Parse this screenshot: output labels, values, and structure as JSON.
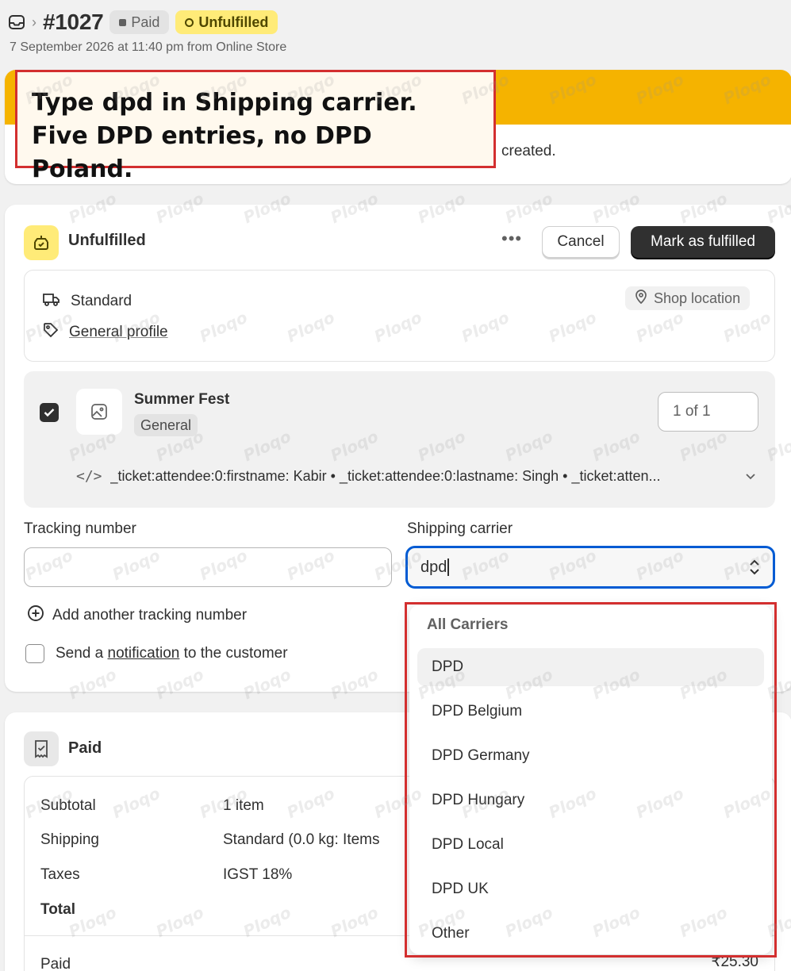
{
  "order": {
    "number": "#1027",
    "payment_badge": "Paid",
    "fulfillment_badge": "Unfulfilled",
    "subtitle": "7 September 2026 at 11:40 pm from Online Store"
  },
  "alert": {
    "visible_tail": "created."
  },
  "annotation": {
    "line1": "Type dpd in Shipping carrier.",
    "line2": "Five DPD entries, no DPD Poland."
  },
  "fulfillment": {
    "title": "Unfulfilled",
    "more_label": "•••",
    "cancel_label": "Cancel",
    "mark_label": "Mark as fulfilled",
    "method": "Standard",
    "profile": "General profile",
    "location": "Shop location",
    "item": {
      "name": "Summer Fest",
      "tag": "General",
      "quantity": "1 of 1",
      "properties": "_ticket:attendee:0:firstname: Kabir • _ticket:attendee:0:lastname: Singh • _ticket:atten..."
    },
    "tracking_label": "Tracking number",
    "tracking_value": "",
    "carrier_label": "Shipping carrier",
    "carrier_value": "dpd",
    "add_tracking": "Add another tracking number",
    "notify_prefix": "Send a ",
    "notify_link": "notification",
    "notify_suffix": " to the customer"
  },
  "dropdown": {
    "section": "All Carriers",
    "options": [
      "DPD",
      "DPD Belgium",
      "DPD Germany",
      "DPD Hungary",
      "DPD Local",
      "DPD UK",
      "Other"
    ]
  },
  "payment": {
    "title": "Paid",
    "rows": [
      {
        "label": "Subtotal",
        "value": "1 item"
      },
      {
        "label": "Shipping",
        "value": "Standard (0.0 kg: Items"
      },
      {
        "label": "Taxes",
        "value": "IGST 18%"
      },
      {
        "label": "Total",
        "value": ""
      }
    ],
    "paid_label": "Paid",
    "paid_amount": "₹25.30"
  },
  "watermark": "Ploqo",
  "colors": {
    "accent": "#005bd3",
    "warning_band": "#f5b300",
    "unfulfilled_badge": "#ffeb78",
    "primary_button": "#303030",
    "annotation_border": "#d32f2f"
  }
}
